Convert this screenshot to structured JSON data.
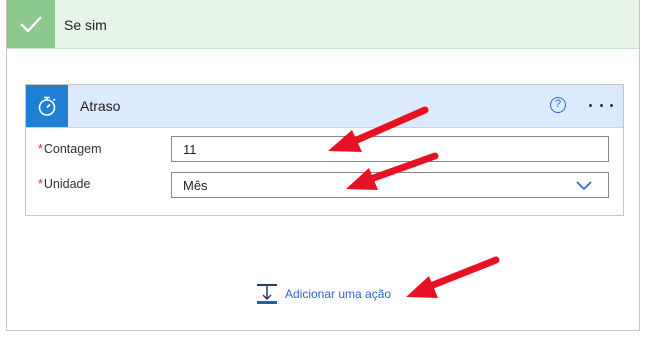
{
  "branch": {
    "title": "Se sim",
    "check_icon": "checkmark-icon",
    "colors": {
      "header_bg": "#e6f4e8",
      "check_bg": "#8bc98d"
    }
  },
  "action_card": {
    "title": "Atraso",
    "icon": "timer-icon",
    "help_symbol": "?",
    "more_icon": "ellipsis-icon",
    "colors": {
      "icon_bg": "#1e7fd3",
      "header_bg": "#dceafd"
    },
    "fields": {
      "count": {
        "required_marker": "*",
        "label": "Contagem",
        "value": "11"
      },
      "unit": {
        "required_marker": "*",
        "label": "Unidade",
        "value": "Mês",
        "dropdown_icon": "chevron-down-icon"
      }
    }
  },
  "add_action": {
    "label": "Adicionar uma ação",
    "icon": "insert-step-icon"
  },
  "annotations": {
    "arrow_color": "#e81123"
  }
}
